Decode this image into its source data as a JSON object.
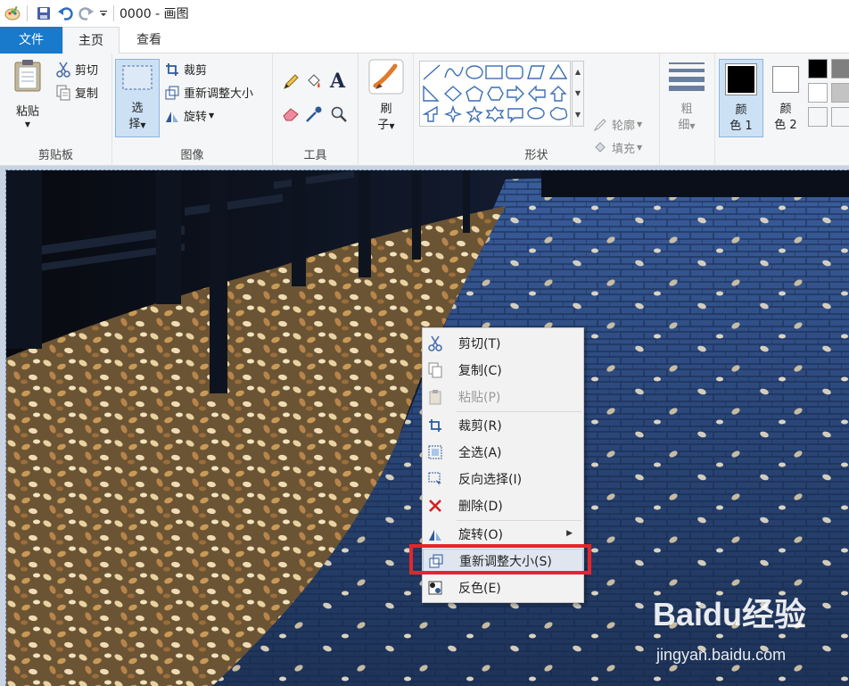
{
  "title_bar": {
    "title": "0000 - 画图"
  },
  "tabs": {
    "file": "文件",
    "home": "主页",
    "view": "查看"
  },
  "ribbon": {
    "clipboard": {
      "paste": "粘贴",
      "cut": "剪切",
      "copy": "复制",
      "group": "剪贴板"
    },
    "image": {
      "select_top": "选",
      "select_bottom": "择",
      "crop": "裁剪",
      "resize": "重新调整大小",
      "rotate": "旋转",
      "group": "图像"
    },
    "tools": {
      "group": "工具"
    },
    "brush": {
      "label_top": "刷",
      "label_bottom": "子"
    },
    "shapes": {
      "outline": "轮廓",
      "fill": "填充",
      "group": "形状"
    },
    "size": {
      "top": "粗",
      "bottom": "细"
    },
    "color1": {
      "top": "颜",
      "bottom": "色 1"
    },
    "color2": {
      "top": "颜",
      "bottom": "色 2"
    },
    "palette_colors": [
      "#000000",
      "#7f7f7f",
      "#ffffff",
      "#c3c3c3"
    ]
  },
  "context_menu": {
    "items": [
      {
        "label": "剪切(T)",
        "icon": "scissors-icon",
        "enabled": true
      },
      {
        "label": "复制(C)",
        "icon": "copy-icon",
        "enabled": true
      },
      {
        "label": "粘贴(P)",
        "icon": "paste-icon",
        "enabled": false
      },
      {
        "label": "裁剪(R)",
        "icon": "crop-icon",
        "enabled": true
      },
      {
        "label": "全选(A)",
        "icon": "select-all-icon",
        "enabled": true
      },
      {
        "label": "反向选择(I)",
        "icon": "invert-selection-icon",
        "enabled": true
      },
      {
        "label": "删除(D)",
        "icon": "delete-icon",
        "enabled": true
      },
      {
        "label": "旋转(O)",
        "icon": "rotate-icon",
        "enabled": true
      },
      {
        "label": "重新调整大小(S)",
        "icon": "resize-icon",
        "enabled": true
      },
      {
        "label": "反色(E)",
        "icon": "invert-color-icon",
        "enabled": true
      }
    ]
  },
  "watermark": {
    "brand": "Baidu经验",
    "url": "jingyan.baidu.com"
  },
  "colors": {
    "accent": "#1979ca",
    "highlight": "#e8242b"
  }
}
